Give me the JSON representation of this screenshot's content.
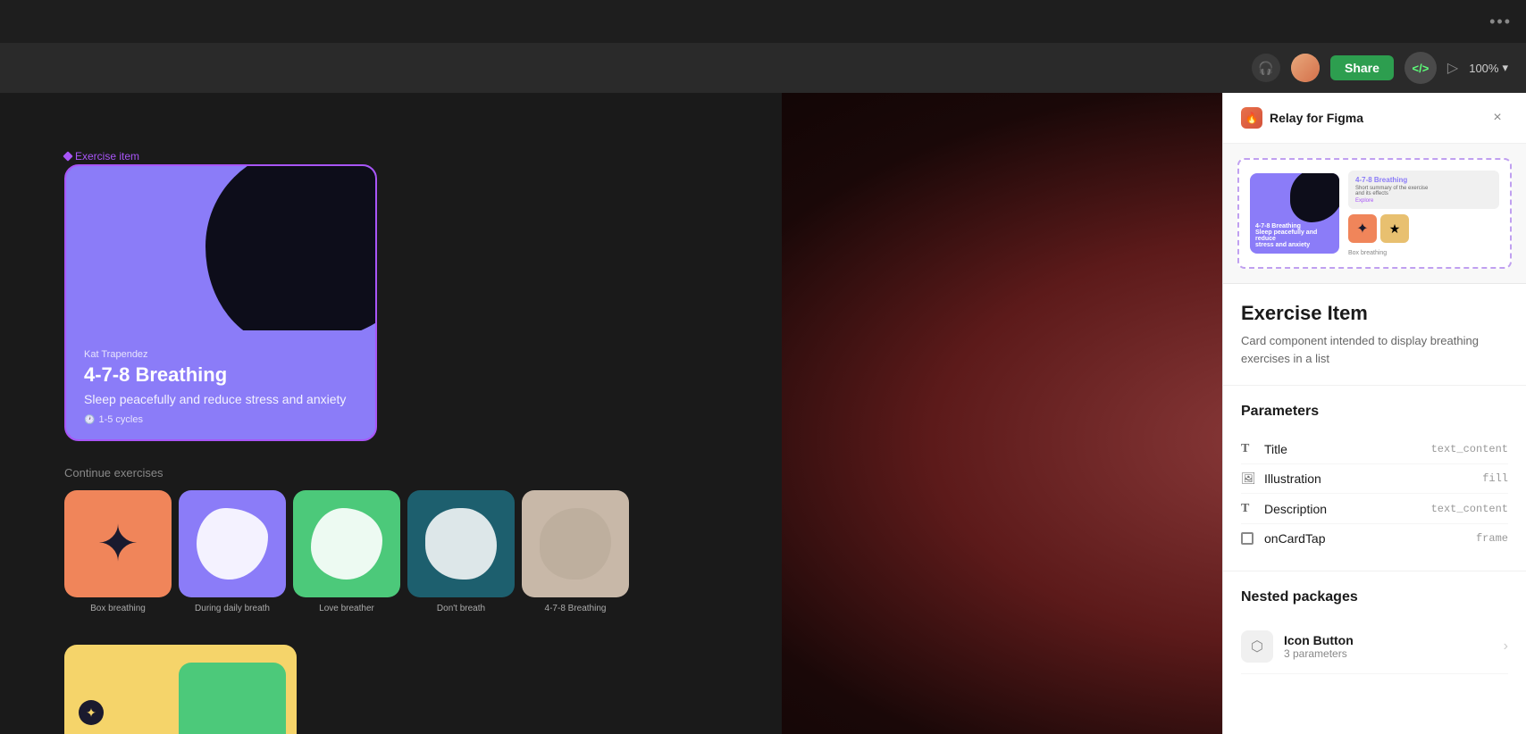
{
  "app": {
    "title": "Relay for Figma",
    "zoom": "100%"
  },
  "toolbar": {
    "dots_label": "•••",
    "share_label": "Share",
    "code_label": "</>",
    "zoom_label": "100%"
  },
  "canvas": {
    "exercise_label": "Exercise item",
    "card": {
      "author": "Kat Trapendez",
      "title": "4-7-8 Breathing",
      "subtitle": "Sleep peacefully and reduce stress and anxiety",
      "meta": "1-5 cycles"
    },
    "continue_title": "Continue exercises",
    "exercise_items": [
      {
        "label": "Box breathing",
        "color": "orange"
      },
      {
        "label": "During daily breath",
        "color": "purple"
      },
      {
        "label": "Love breather",
        "color": "green"
      },
      {
        "label": "Don't breath",
        "color": "teal"
      },
      {
        "label": "4-7-8 Breathing",
        "color": "beige"
      }
    ]
  },
  "panel": {
    "title": "Relay for Figma",
    "close_label": "×",
    "component_name": "Exercise Item",
    "component_description": "Card component intended to display breathing exercises in a list",
    "parameters_heading": "Parameters",
    "parameters": [
      {
        "icon": "T",
        "name": "Title",
        "type": "text_content"
      },
      {
        "icon": "img",
        "name": "Illustration",
        "type": "fill"
      },
      {
        "icon": "T",
        "name": "Description",
        "type": "text_content"
      },
      {
        "icon": "frame",
        "name": "onCardTap",
        "type": "frame"
      }
    ],
    "nested_heading": "Nested packages",
    "nested_items": [
      {
        "name": "Icon Button",
        "params": "3 parameters"
      }
    ]
  }
}
